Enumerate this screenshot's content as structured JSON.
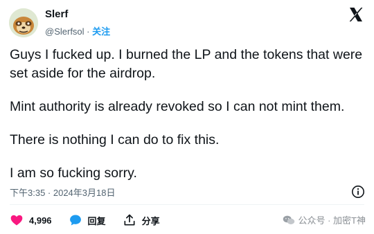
{
  "author": {
    "name": "Slerf",
    "handle": "@Slerfsol",
    "separator": "·",
    "follow_label": "关注"
  },
  "tweet": {
    "paragraphs": [
      "Guys I fucked up. I burned the LP and the tokens that were set aside for the airdrop.",
      "Mint authority is already revoked so I can not mint them.",
      "There is nothing I can do to fix this.",
      "I am so fucking sorry."
    ],
    "timestamp": "下午3:35 · 2024年3月18日"
  },
  "actions": {
    "like_count": "4,996",
    "reply_label": "回复",
    "share_label": "分享"
  },
  "watermark": "公众号 · 加密T神",
  "colors": {
    "like": "#f91880",
    "reply": "#1d9bf0",
    "follow": "#1d9bf0",
    "muted": "#536471"
  },
  "icons": [
    "x-logo-icon",
    "info-icon",
    "heart-icon",
    "reply-bubble-icon",
    "share-icon",
    "wechat-icon"
  ]
}
